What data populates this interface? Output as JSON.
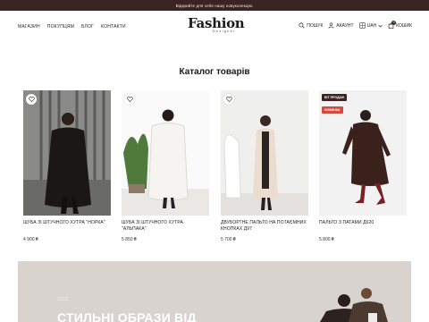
{
  "announcement": "Відкрийте для себе нашу новуколекцію.",
  "nav": {
    "left": [
      "МАГАЗИН",
      "ПОКУПЦЯМ",
      "БЛОГ",
      "КОНТАКТИ"
    ],
    "search": "ПОШУК",
    "account": "АКАУНТ",
    "currency": "UAH",
    "cart": "КОШИК",
    "cart_count": "0"
  },
  "logo": {
    "main": "Fashion",
    "sub": "Designer"
  },
  "catalog": {
    "title": "Каталог товарів",
    "products": [
      {
        "title": "ШУБА ЗІ ШТУЧНОГО ХУТРА \"НОРКА\"",
        "price": "4 900 ₴"
      },
      {
        "title": "ШУБА ЗІ ШТУЧНОГО ХУТРА \"АЛЬПАКА\"",
        "price": "5 850 ₴"
      },
      {
        "title": "ДВУБОРТНЕ ПАЛЬТО НА ПОТАЄМНИХ КНОПКАХ Д97",
        "price": "5 700 ₴"
      },
      {
        "title": "ПАЛЬТО З ПАТАМИ Д620",
        "price": "5 800 ₴",
        "badges": [
          "ВІТ ПРОДАЖ",
          "НОВИНКА"
        ]
      }
    ]
  },
  "banner": {
    "year": "2023",
    "headline": "СТИЛЬНІ ОБРАЗИ ВІД"
  },
  "colors": {
    "topbar": "#3a2320",
    "sale_badge": "#3a2320",
    "new_badge": "#d34a3f",
    "banner_bg": "#d8d3cf"
  }
}
